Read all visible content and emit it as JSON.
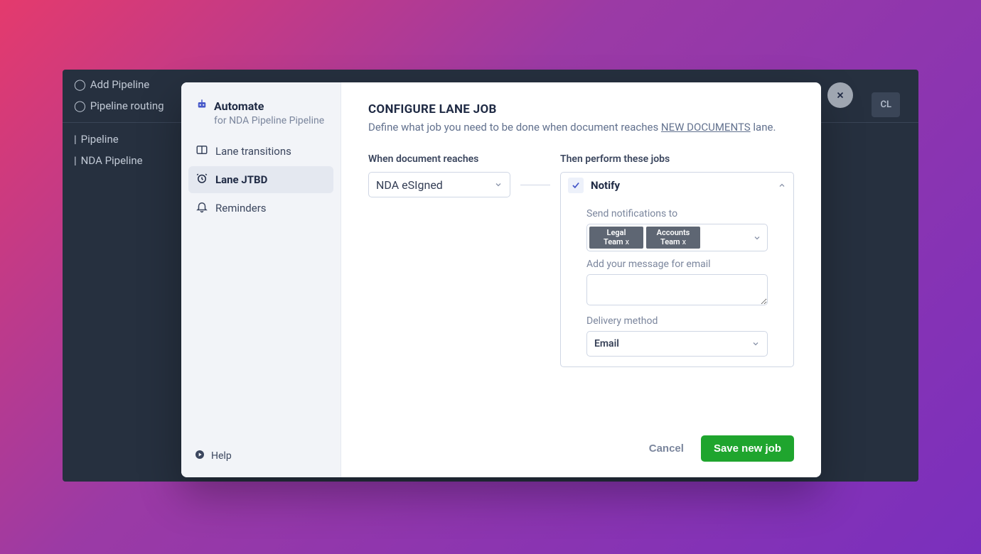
{
  "background": {
    "items": [
      "Add Pipeline",
      "Pipeline routing",
      "Pipeline",
      "NDA Pipeline"
    ],
    "tag": "CL"
  },
  "sidebar": {
    "title": "Automate",
    "subtitle": "for NDA Pipeline Pipeline",
    "items": [
      {
        "label": "Lane transitions",
        "active": false
      },
      {
        "label": "Lane JTBD",
        "active": true
      },
      {
        "label": "Reminders",
        "active": false
      }
    ],
    "help": "Help"
  },
  "main": {
    "title": "CONFIGURE LANE JOB",
    "subtitle_prefix": "Define what job you need to be done when document reaches ",
    "subtitle_lane": "NEW DOCUMENTS",
    "subtitle_suffix": " lane.",
    "when_label": "When document reaches",
    "when_value": "NDA eSIgned",
    "then_label": "Then perform these jobs",
    "job": {
      "name": "Notify",
      "send_to_label": "Send notifications to",
      "recipients": [
        {
          "line1": "Legal",
          "line2": "Team"
        },
        {
          "line1": "Accounts",
          "line2": "Team"
        }
      ],
      "message_label": "Add your message for email",
      "message_value": "",
      "delivery_label": "Delivery method",
      "delivery_value": "Email"
    },
    "cancel": "Cancel",
    "save": "Save new job"
  }
}
